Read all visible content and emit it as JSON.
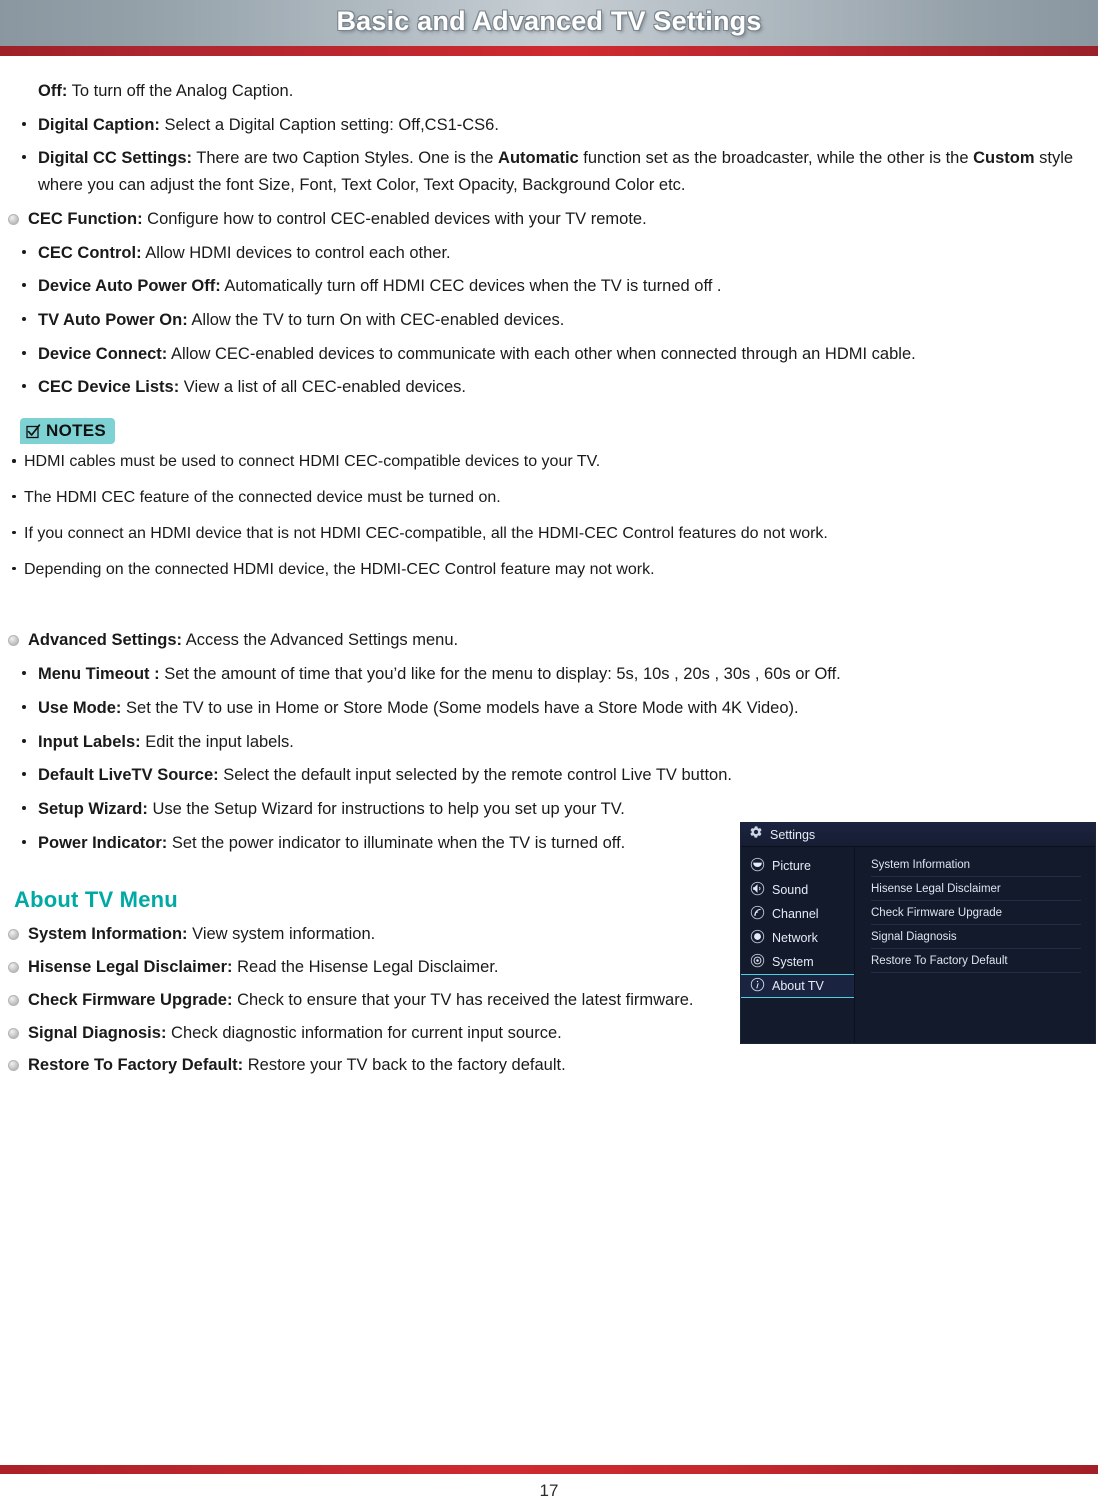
{
  "header": {
    "title": "Basic and Advanced TV Settings"
  },
  "body": {
    "off_item": {
      "term": "Off:",
      "desc": " To turn off the Analog Caption."
    },
    "caption_bullets": [
      {
        "term": "Digital Caption:",
        "desc": " Select a Digital Caption setting: Off,CS1-CS6."
      }
    ],
    "digital_cc": {
      "term": "Digital CC Settings:",
      "part1": " There are two Caption Styles. One is the ",
      "bold1": "Automatic",
      "part2": " function set as the broadcaster, while the other is the ",
      "bold2": "Custom",
      "part3": " style where you can adjust the font Size, Font, Text Color, Text Opacity, Background Color etc."
    },
    "cec_function": {
      "term": "CEC Function:",
      "desc": " Configure how to control CEC-enabled devices with your TV remote."
    },
    "cec_items": [
      {
        "term": "CEC Control:",
        "desc": " Allow HDMI devices to control each other."
      },
      {
        "term": "Device Auto Power Off:",
        "desc": " Automatically turn off HDMI CEC devices when the TV is turned off ."
      },
      {
        "term": "TV Auto Power On:",
        "desc": " Allow the TV to turn On with CEC-enabled devices."
      },
      {
        "term": "Device Connect:",
        "desc": " Allow CEC-enabled devices to communicate with each other when connected through an HDMI cable."
      },
      {
        "term": "CEC Device Lists:",
        "desc": " View a list of all CEC-enabled devices."
      }
    ],
    "notes": {
      "label": "NOTES",
      "items": [
        "HDMI cables must be used to connect HDMI CEC-compatible devices to your TV.",
        "The HDMI CEC feature of the connected device must be turned on.",
        "If you connect an HDMI device that is not HDMI CEC-compatible, all the HDMI-CEC Control features do not work.",
        "Depending on the connected HDMI device, the HDMI-CEC Control feature may not work."
      ]
    },
    "advanced_settings": {
      "term": "Advanced Settings:",
      "desc": " Access the Advanced Settings menu."
    },
    "advanced_items": [
      {
        "term": "Menu Timeout :",
        "desc": " Set the amount of time that you’d like for the menu to display: 5s, 10s , 20s , 30s , 60s or Off."
      },
      {
        "term": "Use Mode:",
        "desc": " Set the TV to use in Home or Store Mode (Some models have a Store Mode with 4K Video)."
      },
      {
        "term": "Input Labels:",
        "desc": " Edit the input labels."
      },
      {
        "term": "Default LiveTV Source:",
        "desc": " Select the default input selected by the remote control Live TV button."
      },
      {
        "term": "Setup Wizard:",
        "desc": " Use the Setup Wizard for instructions to help you set up your TV."
      },
      {
        "term": "Power Indicator:",
        "desc": " Set the power indicator to illuminate when the TV is turned off."
      }
    ],
    "about_heading": "About TV Menu",
    "about_items": [
      {
        "term": "System Information:",
        "desc": " View system information."
      },
      {
        "term": "Hisense Legal Disclaimer:",
        "desc": " Read the Hisense Legal Disclaimer."
      },
      {
        "term": "Check Firmware Upgrade:",
        "desc": " Check to ensure that your TV has received the latest firmware."
      },
      {
        "term": "Signal Diagnosis:",
        "desc": "  Check diagnostic information for current input source."
      },
      {
        "term": "Restore To Factory Default:",
        "desc": " Restore your TV back to the factory default."
      }
    ]
  },
  "tv_menu": {
    "title": "Settings",
    "sidebar": [
      {
        "label": "Picture",
        "icon": "picture-icon",
        "active": false
      },
      {
        "label": "Sound",
        "icon": "sound-icon",
        "active": false
      },
      {
        "label": "Channel",
        "icon": "channel-icon",
        "active": false
      },
      {
        "label": "Network",
        "icon": "network-icon",
        "active": false
      },
      {
        "label": "System",
        "icon": "system-icon",
        "active": false
      },
      {
        "label": "About TV",
        "icon": "info-icon",
        "active": true
      }
    ],
    "rows": [
      "System Information",
      "Hisense Legal Disclaimer",
      "Check Firmware Upgrade",
      "Signal Diagnosis",
      "Restore To Factory Default"
    ]
  },
  "footer": {
    "page_number": "17"
  },
  "colors": {
    "accent_teal": "#00a9a4",
    "notes_bg": "#7ed2d3",
    "rule_red": "#cf2a2f",
    "menu_bg": "#121a2c",
    "menu_highlight": "#4fd0e0"
  }
}
